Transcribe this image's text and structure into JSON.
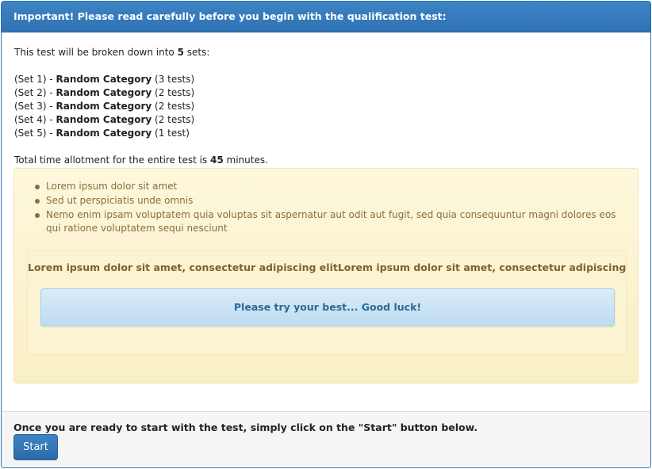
{
  "header": {
    "title": "Important! Please read carefully before you begin with the qualification test:"
  },
  "intro": {
    "prefix": "This test will be broken down into ",
    "count": "5",
    "suffix": " sets:"
  },
  "sets": [
    {
      "label": "(Set 1) - ",
      "category": "Random Category",
      "tests": " (3 tests)"
    },
    {
      "label": "(Set 2) - ",
      "category": "Random Category",
      "tests": " (2 tests)"
    },
    {
      "label": "(Set 3) - ",
      "category": "Random Category",
      "tests": " (2 tests)"
    },
    {
      "label": "(Set 4) - ",
      "category": "Random Category",
      "tests": " (2 tests)"
    },
    {
      "label": "(Set 5) - ",
      "category": "Random Category",
      "tests": " (1 test)"
    }
  ],
  "time": {
    "prefix": "Total time allotment for the entire test is ",
    "minutes": "45",
    "suffix": " minutes."
  },
  "warning": {
    "bullets": [
      "Lorem ipsum dolor sit amet",
      "Sed ut perspiciatis unde omnis",
      "Nemo enim ipsam voluptatem quia voluptas sit aspernatur aut odit aut fugit, sed quia consequuntur magni dolores eos qui ratione voluptatem sequi nesciunt"
    ],
    "inner_text": "Lorem ipsum dolor sit amet, consectetur adipiscing elitLorem ipsum dolor sit amet, consectetur adipiscing",
    "info_text": "Please try your best... Good luck!"
  },
  "footer": {
    "instruction": "Once you are ready to start with the test, simply click on the \"Start\" button below.",
    "start_label": "Start"
  },
  "colors": {
    "primary": "#3276b1",
    "warning_text": "#8a6d3b",
    "info_text": "#2b6a96"
  }
}
